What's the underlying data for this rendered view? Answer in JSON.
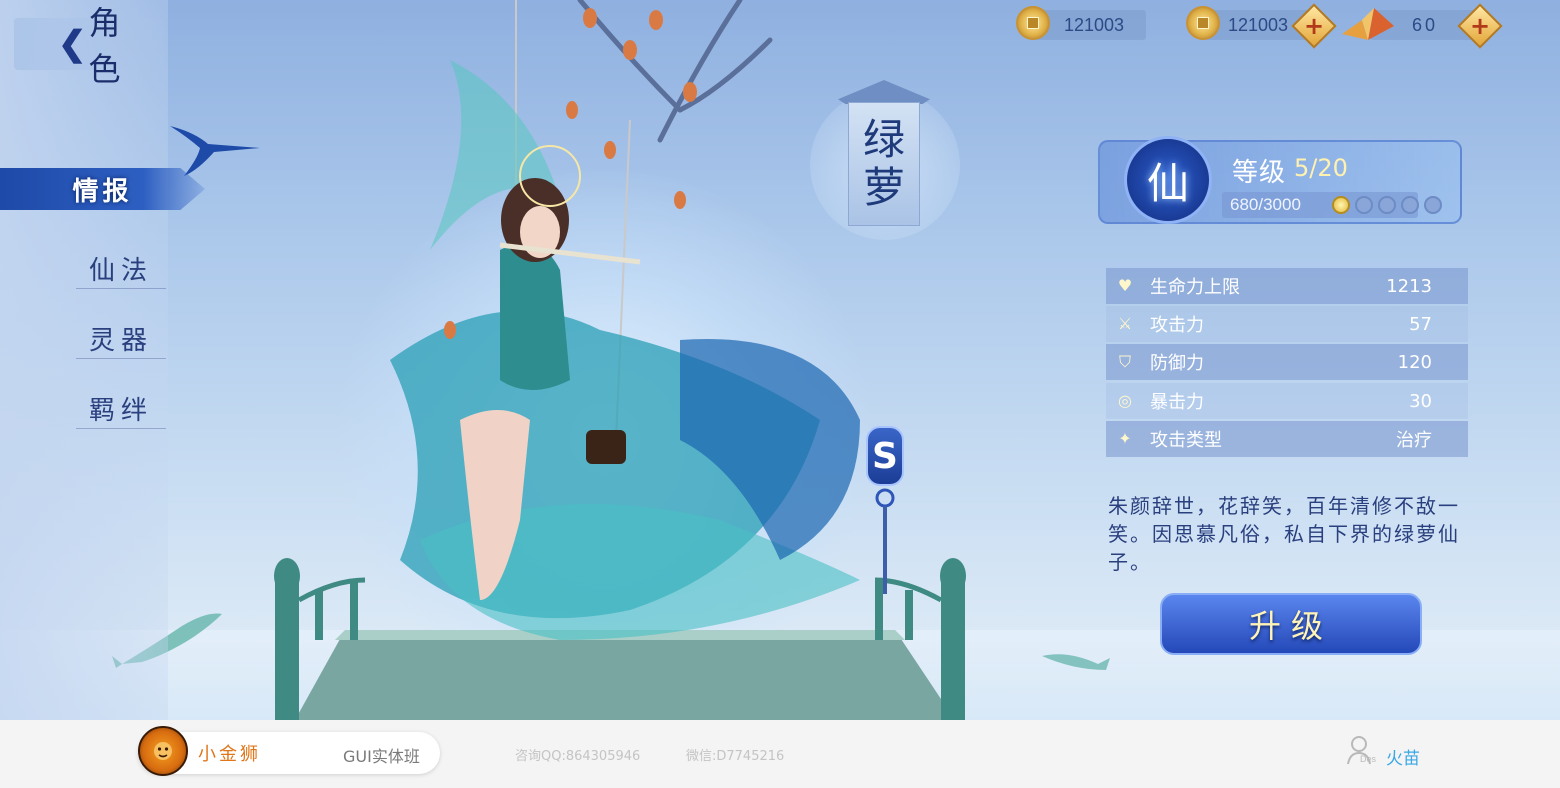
{
  "header": {
    "back_arrow": "❮",
    "title": "角色"
  },
  "resources": [
    {
      "icon": "copper-coin-icon",
      "value": "121003"
    },
    {
      "icon": "copper-coin-icon",
      "value": "121003",
      "add": "+"
    },
    {
      "icon": "paper-crane-icon",
      "value": "60",
      "add": "+"
    }
  ],
  "nav": {
    "active": "情报",
    "items": [
      "仙法",
      "灵器",
      "羁绊"
    ]
  },
  "character": {
    "name_line1": "绿",
    "name_line2": "萝",
    "rank": "S"
  },
  "level": {
    "badge": "仙",
    "label": "等级",
    "value": "5/20",
    "exp": "680/3000",
    "stars_total": 5,
    "stars_lit": 1
  },
  "stats": [
    {
      "icon": "heart-icon",
      "label": "生命力上限",
      "value": "1213"
    },
    {
      "icon": "sword-icon",
      "label": "攻击力",
      "value": "57"
    },
    {
      "icon": "shield-icon",
      "label": "防御力",
      "value": "120"
    },
    {
      "icon": "swirl-icon",
      "label": "暴击力",
      "value": "30"
    },
    {
      "icon": "sparkle-icon",
      "label": "攻击类型",
      "value": "治疗"
    }
  ],
  "description": "朱颜辞世，花辞笑，百年清修不敌一笑。因思慕凡俗，私自下界的绿萝仙子。",
  "upgrade_button": "升级",
  "footer": {
    "brand": "小金狮",
    "course": "GUI实体班",
    "qq": "咨询QQ:864305946",
    "wechat": "微信:D7745216",
    "user_tag": "Des",
    "user": "火苗"
  },
  "colors": {
    "accent_blue": "#2448b8",
    "gold": "#e2b44a",
    "brand_orange": "#e0761a",
    "user_blue": "#37a7e6"
  }
}
